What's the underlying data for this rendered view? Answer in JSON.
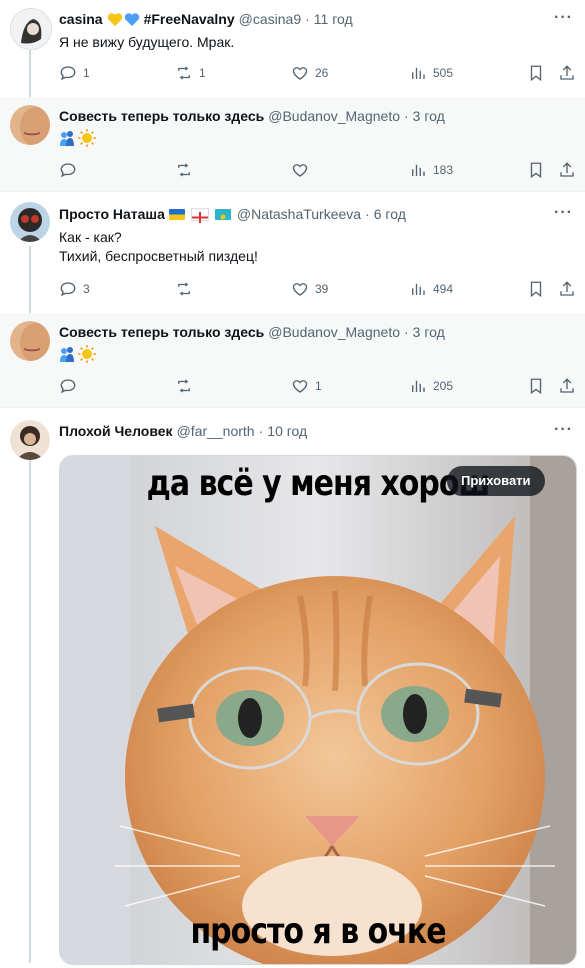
{
  "tweets": [
    {
      "name": "casina",
      "name_suffix": "#FreeNavalny",
      "handle": "@casina9",
      "time": "11 год",
      "lines": [
        "Я не вижу будущего. Мрак."
      ],
      "replies": "1",
      "reposts": "1",
      "likes": "26",
      "views": "505"
    },
    {
      "name": "Совесть теперь только здесь",
      "handle": "@Budanov_Magneto",
      "time": "3 год",
      "lines": [],
      "replies": "",
      "reposts": "",
      "likes": "",
      "views": "183"
    },
    {
      "name": "Просто Наташа",
      "handle": "@NatashaTurkeeva",
      "time": "6 год",
      "lines": [
        "Как - как?",
        "Тихий, беспросветный пиздец!"
      ],
      "replies": "3",
      "reposts": "",
      "likes": "39",
      "views": "494"
    },
    {
      "name": "Совесть теперь только здесь",
      "handle": "@Budanov_Magneto",
      "time": "3 год",
      "lines": [],
      "replies": "",
      "reposts": "",
      "likes": "1",
      "views": "205"
    },
    {
      "name": "Плохой Человек",
      "handle": "@far__north",
      "time": "10 год",
      "media_button": "Приховати",
      "meme_top": "да всё у меня хорош",
      "meme_bottom": "просто я в очке"
    }
  ],
  "separator": "·",
  "more_label": "···",
  "colors": {
    "accent": "#1d9bf0",
    "muted": "#536471",
    "heart_blue": "#4d9ef6",
    "heart_yellow": "#f5c518"
  }
}
